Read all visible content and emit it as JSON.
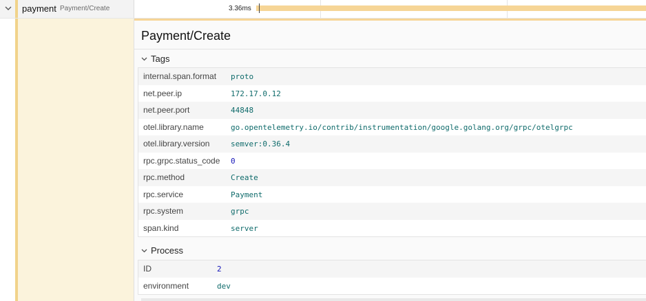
{
  "span": {
    "service": "payment",
    "operation": "Payment/Create",
    "duration": "3.36ms"
  },
  "detail": {
    "title": "Payment/Create",
    "tags_label": "Tags",
    "tags": [
      {
        "key": "internal.span.format",
        "value": "proto"
      },
      {
        "key": "net.peer.ip",
        "value": "172.17.0.12"
      },
      {
        "key": "net.peer.port",
        "value": "44848"
      },
      {
        "key": "otel.library.name",
        "value": "go.opentelemetry.io/contrib/instrumentation/google.golang.org/grpc/otelgrpc"
      },
      {
        "key": "otel.library.version",
        "value": "semver:0.36.4"
      },
      {
        "key": "rpc.grpc.status_code",
        "value": "0"
      },
      {
        "key": "rpc.method",
        "value": "Create"
      },
      {
        "key": "rpc.service",
        "value": "Payment"
      },
      {
        "key": "rpc.system",
        "value": "grpc"
      },
      {
        "key": "span.kind",
        "value": "server"
      }
    ],
    "process_label": "Process",
    "process": [
      {
        "key": "ID",
        "value": "2"
      },
      {
        "key": "environment",
        "value": "dev"
      }
    ]
  },
  "colors": {
    "service_accent": "#f1d38a",
    "span_bar": "#f6d596",
    "value_text": "#0f6b6b",
    "number_text": "#1414b8"
  },
  "icons": [
    "chevron-down-icon"
  ]
}
